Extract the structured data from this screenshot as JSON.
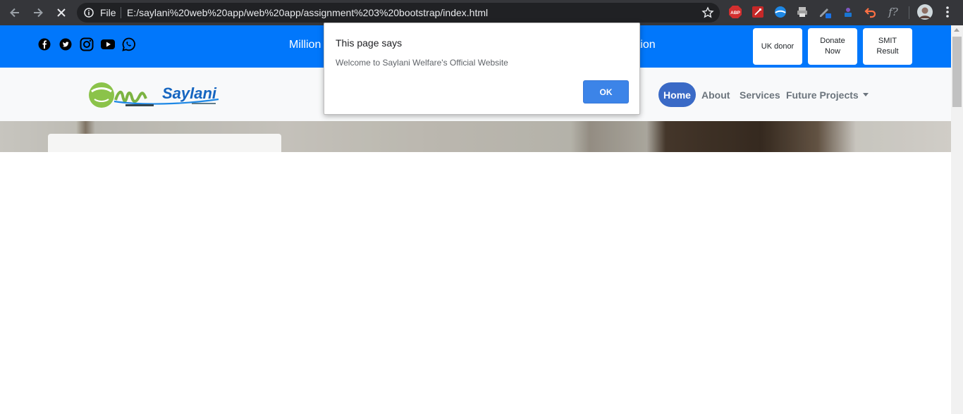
{
  "browser": {
    "file_label": "File",
    "url": "E:/saylani%20web%20app/web%20app/assignment%203%20bootstrap/index.html",
    "extensions": [
      "adblock-icon",
      "pdf-icon",
      "globe-icon",
      "print-icon",
      "pen-icon",
      "toolbox-icon",
      "undo-icon",
      "function-icon",
      "profile-avatar"
    ],
    "ext_abp": "ABP",
    "ext_fx": "f?"
  },
  "topbar": {
    "color": "#0177fb",
    "social": [
      "facebook-icon",
      "twitter-icon",
      "instagram-icon",
      "youtube-icon",
      "whatsapp-icon"
    ],
    "tagline_left": "Million",
    "tagline_right": "ation",
    "buttons": [
      {
        "label": "UK donor"
      },
      {
        "label": "Donate Now"
      },
      {
        "label": "SMIT Result"
      }
    ]
  },
  "navbar": {
    "logo_text": "Saylani",
    "links": {
      "home": "Home",
      "about": "About",
      "services": "Services",
      "future": "Future Projects"
    }
  },
  "dialog": {
    "title": "This page says",
    "message": "Welcome to Saylani Welfare's Official Website",
    "ok": "OK"
  }
}
